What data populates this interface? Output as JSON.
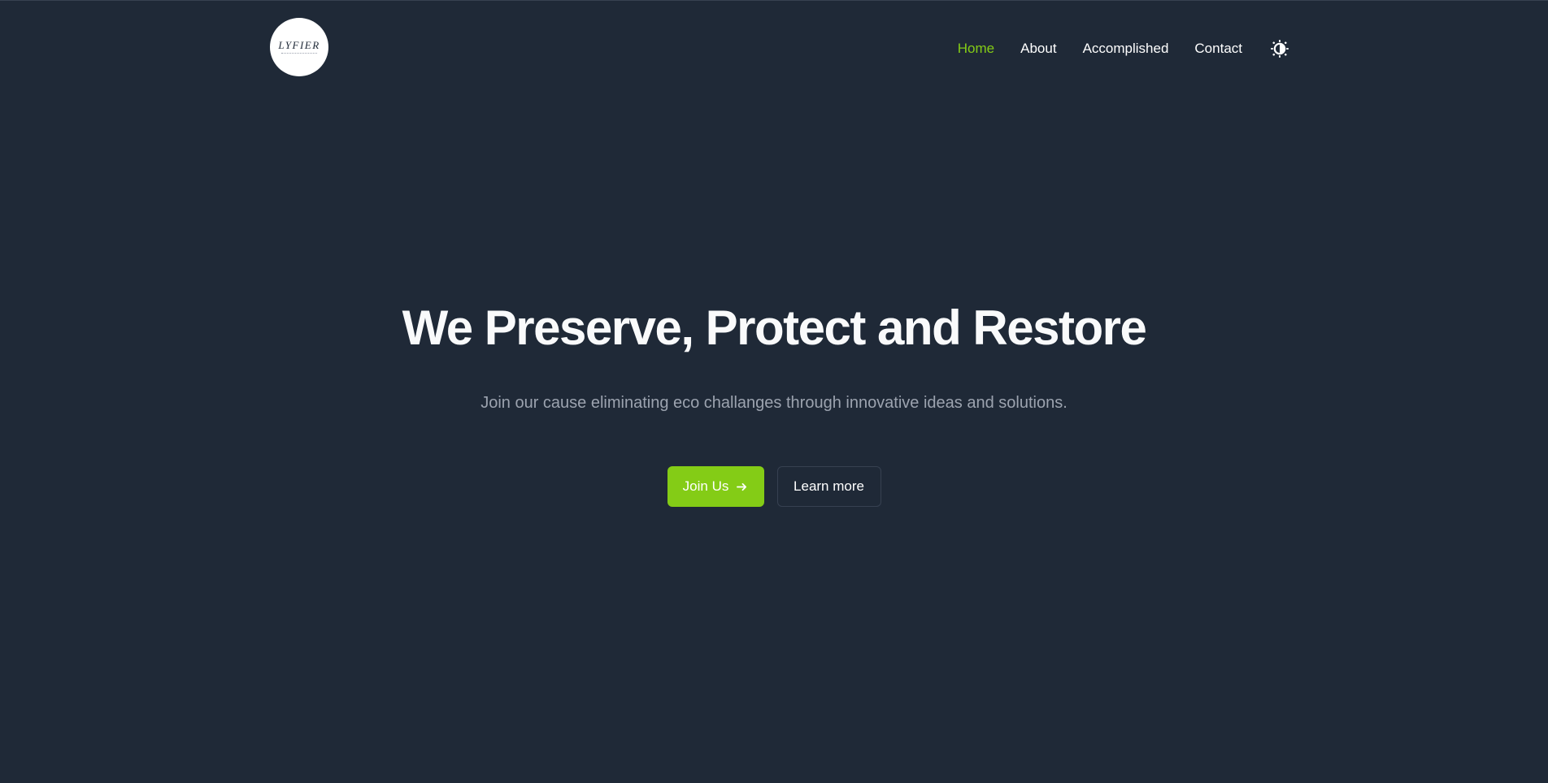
{
  "brand": {
    "logo_text": "LYFIER",
    "colors": {
      "background": "#1f2937",
      "accent": "#84cc16",
      "text": "#ffffff",
      "muted": "#9ca3af"
    }
  },
  "nav": {
    "items": [
      {
        "label": "Home",
        "active": true
      },
      {
        "label": "About",
        "active": false
      },
      {
        "label": "Accomplished",
        "active": false
      },
      {
        "label": "Contact",
        "active": false
      }
    ],
    "theme_toggle_icon": "contrast-icon"
  },
  "hero": {
    "title": "We Preserve, Protect and Restore",
    "subtitle": "Join our cause eliminating eco challanges through innovative ideas and solutions.",
    "primary_button": {
      "label": "Join Us",
      "icon": "arrow-right-icon"
    },
    "secondary_button": {
      "label": "Learn more"
    }
  }
}
